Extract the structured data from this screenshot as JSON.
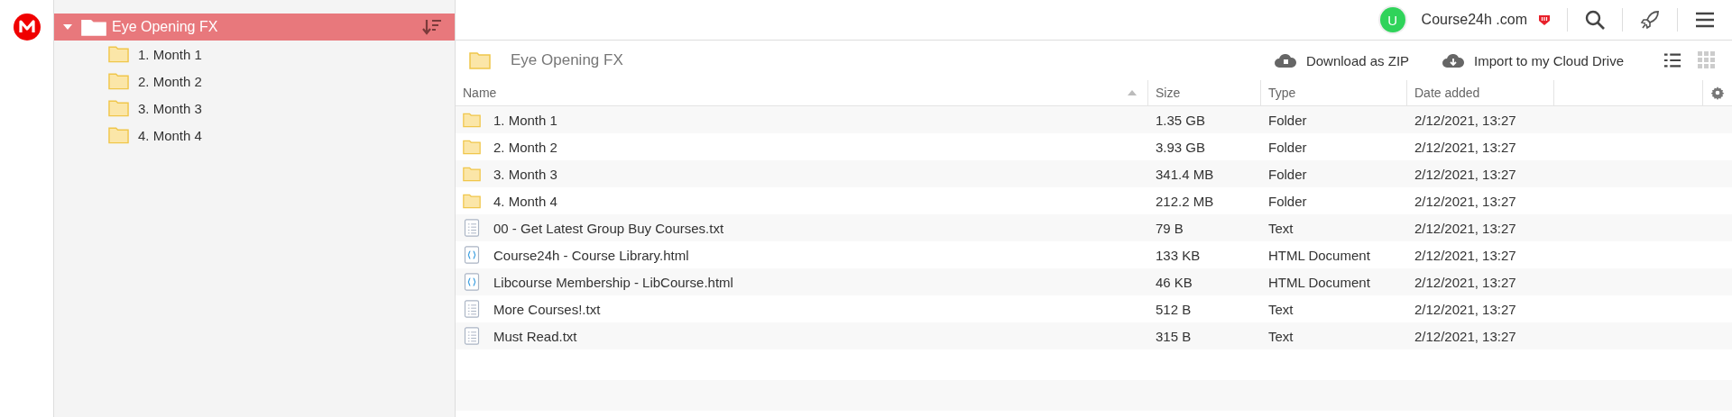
{
  "tree": {
    "label": "Eye Opening FX",
    "expanded": true,
    "selected": true,
    "children": [
      {
        "label": "1. Month 1"
      },
      {
        "label": "2. Month 2"
      },
      {
        "label": "3. Month 3"
      },
      {
        "label": "4. Month 4"
      }
    ]
  },
  "account": {
    "avatar": "U",
    "name": "Course24h .com"
  },
  "breadcrumb": "Eye Opening FX",
  "actions": [
    "Download as ZIP",
    "Import to my Cloud Drive"
  ],
  "view": {
    "list_selected": true
  },
  "table": {
    "columns": [
      {
        "label": "Name",
        "sorted": true
      },
      {
        "label": "Size",
        "sorted": false
      },
      {
        "label": "Type",
        "sorted": false
      },
      {
        "label": "Date added",
        "sorted": false
      }
    ],
    "rows": [
      {
        "kind": "folder",
        "name": "1. Month 1",
        "size": "1.35 GB",
        "type": "Folder",
        "date": "2/12/2021, 13:27"
      },
      {
        "kind": "folder",
        "name": "2. Month 2",
        "size": "3.93 GB",
        "type": "Folder",
        "date": "2/12/2021, 13:27"
      },
      {
        "kind": "folder",
        "name": "3. Month 3",
        "size": "341.4 MB",
        "type": "Folder",
        "date": "2/12/2021, 13:27"
      },
      {
        "kind": "folder",
        "name": "4. Month 4",
        "size": "212.2 MB",
        "type": "Folder",
        "date": "2/12/2021, 13:27"
      },
      {
        "kind": "text",
        "name": "00 - Get Latest Group Buy Courses.txt",
        "size": "79 B",
        "type": "Text",
        "date": "2/12/2021, 13:27"
      },
      {
        "kind": "html",
        "name": "Course24h - Course Library.html",
        "size": "133 KB",
        "type": "HTML Document",
        "date": "2/12/2021, 13:27"
      },
      {
        "kind": "html",
        "name": "Libcourse Membership - LibCourse.html",
        "size": "46 KB",
        "type": "HTML Document",
        "date": "2/12/2021, 13:27"
      },
      {
        "kind": "text",
        "name": "More Courses!.txt",
        "size": "512 B",
        "type": "Text",
        "date": "2/12/2021, 13:27"
      },
      {
        "kind": "text",
        "name": "Must Read.txt",
        "size": "315 B",
        "type": "Text",
        "date": "2/12/2021, 13:27"
      }
    ]
  }
}
